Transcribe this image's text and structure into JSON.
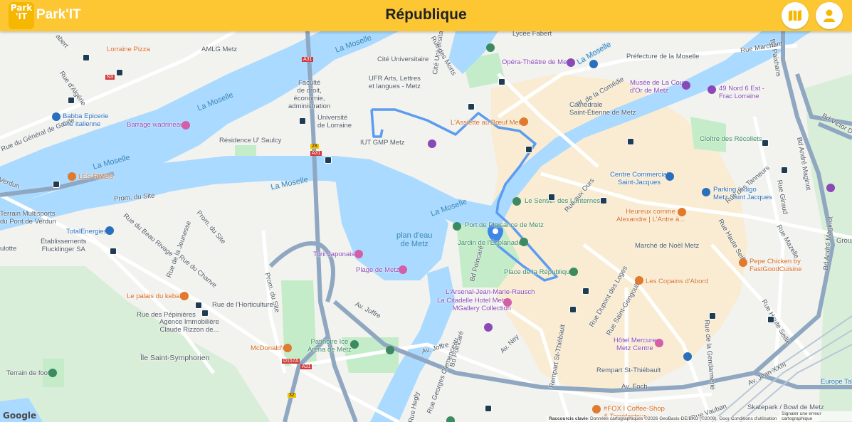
{
  "header": {
    "logo_text": "Park 'IT",
    "brand": "Park'IT",
    "title": "République",
    "map_icon": "map-book-icon",
    "user_icon": "user-icon"
  },
  "colors": {
    "header": "#fdc733",
    "water": "#aadaff",
    "park": "#c4ecc9",
    "route": "#5b9cf0",
    "road_major": "#8fa7c0"
  },
  "map": {
    "water_labels": [
      "La Moselle",
      "La Moselle",
      "La Moselle",
      "La Moselle",
      "La Moselle",
      "La Moselle",
      "plan d'eau\nde Metz"
    ],
    "places": {
      "lorraine_pizza": "Lorraine Pizza",
      "amlg": "AMLG Metz",
      "babba": "Babba Epicerie\nfine italienne",
      "barrage": "Barrage wadrineau",
      "les_rives": "LES RIVES",
      "cite_univ": "Cité Universitaire",
      "ufr": "UFR Arts, Lettres\net langues - Metz",
      "faculte": "Faculté\nde droit,\néconomie,\nadministration",
      "univ_lorraine": "Université\nde Lorraine",
      "residence": "Résidence U' Saulcy",
      "iut": "IUT GMP Metz",
      "lycee": "Lycée Fabert",
      "opera": "Opéra-Théâtre de Metz",
      "prefecture": "Préfecture de la Moselle",
      "musee": "Musée de La Cour\nd'Or de Metz",
      "nord": "49 Nord 6 Est -\nFrac Lorraine",
      "cathedrale": "Cathédrale\nSaint-Étienne de Metz",
      "assiette": "L'Assiette au Bœuf Metz",
      "cloitre": "Cloître des Récollets",
      "centre_commercial": "Centre Commercial\nSaint-Jacques",
      "parking": "Parking Indigo\nMetz Saint Jacques",
      "sentier": "Le Sentier des Lanternes",
      "heureux": "Heureux comme\nAlexandre | L'Antre à...",
      "porte": "Port de Plaisance de Metz",
      "jardin": "Jardin de l'Esplanade",
      "marche": "Marché de Noël Metz",
      "place_rep": "Place de la République",
      "pepe": "Pepe Chicken by\nFastGoodCuisine",
      "copains": "Les Copains d'Abord",
      "arsenal": "L'Arsenal-Jean-Marie-Rausch",
      "citadelle": "La Citadelle Hotel Metz -\nMGallery Collection",
      "torii": "Torii Japonais",
      "plage": "Plage de Metz",
      "hotel_mercure": "Hôtel Mercure\nMetz Centre",
      "fox": "#FOX I Coffee-Shop\n& Torréfacteur",
      "skatepark": "Skatepark / Bowl de Metz",
      "europe": "Europe Tab",
      "group": "Group",
      "terrain_multisports": "Terrain Multisports\ndu Pont de Verdun",
      "totalenergies": "TotalEnergies",
      "etablissements": "Établissements\nFlucklinger SA",
      "palais": "Le palais du kebab",
      "agence": "Agence Immobilière\nClaude Rizzon de...",
      "mcdonalds": "McDonald's",
      "patinoire": "Patinoire Ice\nArena de Metz",
      "ile": "Île Saint-Symphorien",
      "terrain_foot": "Terrain de foot"
    },
    "streets": {
      "bd_paixhans": "Bd Paixhans",
      "rue_marchant": "Rue Marchant",
      "pl_comedie": "Pl. de la Comédie",
      "bd_victor": "Bd Victor De",
      "bd_andre_maginot": "Bd André Maginot",
      "bd_andre_maginot2": "Bd André Maginot",
      "rue_tanneurs": "Rue des Tanneurs",
      "rue_ours": "Rue aux Ours",
      "rue_giraud": "Rue Giraud",
      "rue_mazelle": "Rue Mazelle",
      "rue_haute_seille": "Rue Haute Seille",
      "rue_haute_seille2": "Rue Haute Seille",
      "rue_general_gaulle": "Rue du Général de Gaulle",
      "rue_algerie": "Rue d'Algérie",
      "prom_site": "Prom. du Site",
      "prom_site2": "Prom. du Site",
      "prom_site3": "Prom. du Site",
      "rue_beau_rivage": "Rue du Beau Rivage",
      "rue_jeunesse": "Rue de la Jeunesse",
      "rue_chanve": "Rue du Chanve",
      "rue_horticulture": "Rue de l'Horticulture",
      "rue_pepinieres": "Rue des Pépinières",
      "av_joffre": "Av. Joffre",
      "av_joffre2": "Av. Joffre",
      "av_ney": "Av. Ney",
      "bd_poincare": "Bd Poincaré",
      "bd_poincare2": "Bd Poincaré",
      "rue_georges": "Rue Georges Clemenceau",
      "rue_hegly": "Rue Hegly",
      "rempart": "Rempart St-Thiébault",
      "rempart2": "Rempart St-Thiébault",
      "rue_dupont": "Rue Dupont des Loges",
      "rue_saint_gengoulf": "Rue Saint-Gengoulf",
      "rue_gendarmerie": "Rue de la Gendarmerie",
      "rue_vauban": "Rue Vauban",
      "av_foch": "Av. Foch",
      "av_jean_xxiii": "Av. Jean XXIII",
      "rue_haute_seille3": "Rue Haute Seille",
      "cite_univ_street": "Cité Universitaire",
      "rue_morts": "Rue des Morts",
      "verdun": "Verdun",
      "ulotte": "ulotte",
      "hbert": "abert"
    },
    "shields": [
      "A31",
      "A31",
      "A31",
      "N3",
      "D157A",
      "32",
      "28"
    ],
    "footer": {
      "google": "Google",
      "shortcuts": "Raccourcis clavier",
      "copyright": "Données cartographiques ©2026 GeoBasis-DE/BKG (©2009), Google",
      "terms": "Conditions d'utilisation",
      "report": "Signaler une erreur cartographique"
    }
  }
}
